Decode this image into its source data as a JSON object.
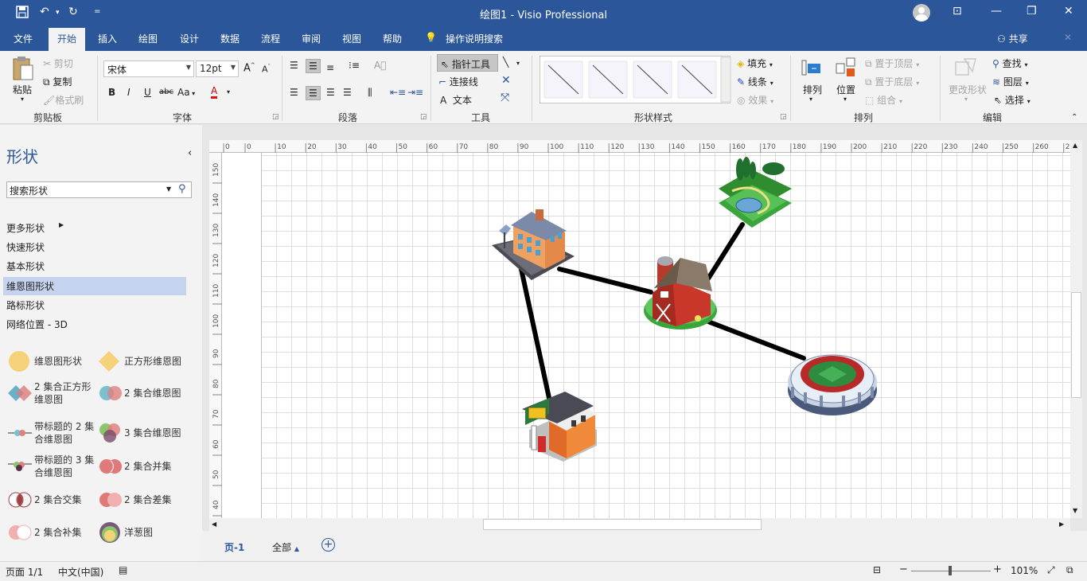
{
  "titlebar": {
    "title": "绘图1  -  Visio Professional"
  },
  "tabs": [
    "文件",
    "开始",
    "插入",
    "绘图",
    "设计",
    "数据",
    "流程",
    "审阅",
    "视图",
    "帮助"
  ],
  "tell_me": "操作说明搜索",
  "share": "共享",
  "ribbon": {
    "clipboard": {
      "paste": "粘贴",
      "cut": "剪切",
      "copy": "复制",
      "format_painter": "格式刷",
      "label": "剪贴板"
    },
    "font": {
      "name": "宋体",
      "size": "12pt",
      "bold": "B",
      "italic": "I",
      "underline": "U",
      "strike": "abc",
      "case": "Aa",
      "color": "A",
      "grow": "A",
      "shrink": "A",
      "label": "字体"
    },
    "paragraph": {
      "label": "段落"
    },
    "tools": {
      "pointer": "指针工具",
      "connector": "连接线",
      "text": "文本",
      "label": "工具"
    },
    "shape_styles": {
      "fill": "填充",
      "line": "线条",
      "effects": "效果",
      "label": "形状样式"
    },
    "arrange": {
      "arrange": "排列",
      "position": "位置",
      "bring_front": "置于顶层",
      "send_back": "置于底层",
      "group": "组合",
      "label": "排列"
    },
    "editing": {
      "change_shape": "更改形状",
      "find": "查找",
      "layers": "图层",
      "select": "选择",
      "label": "编辑"
    }
  },
  "shapes_pane": {
    "title": "形状",
    "search_placeholder": "搜索形状",
    "categories": [
      "更多形状",
      "快速形状",
      "基本形状",
      "维恩图形状",
      "路标形状",
      "网络位置 - 3D"
    ],
    "selected_category": "维恩图形状",
    "stencils": [
      {
        "label": "维恩图形状"
      },
      {
        "label": "正方形维恩图"
      },
      {
        "label": "2 集合正方形维恩图"
      },
      {
        "label": "2 集合维恩图"
      },
      {
        "label": "带标题的 2 集合维恩图"
      },
      {
        "label": "3 集合维恩图"
      },
      {
        "label": "带标题的 3 集合维恩图"
      },
      {
        "label": "2 集合并集"
      },
      {
        "label": "2 集合交集"
      },
      {
        "label": "2 集合差集"
      },
      {
        "label": "2 集合补集"
      },
      {
        "label": "洋葱图"
      }
    ]
  },
  "ruler": {
    "top": [
      "0",
      "0",
      "10",
      "20",
      "30",
      "40",
      "50",
      "60",
      "70",
      "80",
      "90",
      "100",
      "110",
      "120",
      "130",
      "140",
      "150",
      "160",
      "170",
      "180",
      "190",
      "200",
      "210",
      "220",
      "230",
      "240",
      "250",
      "260",
      "270"
    ],
    "left": [
      "150",
      "140",
      "130",
      "120",
      "110",
      "100",
      "90",
      "80",
      "70",
      "60",
      "50",
      "40"
    ]
  },
  "diagram": {
    "nodes": [
      "town-building",
      "park",
      "barn",
      "stadium",
      "gas-station"
    ],
    "connections": [
      [
        "town-building",
        "barn"
      ],
      [
        "park",
        "barn"
      ],
      [
        "barn",
        "stadium"
      ],
      [
        "town-building",
        "gas-station"
      ]
    ]
  },
  "page_tabs": {
    "current": "页-1",
    "all": "全部"
  },
  "status": {
    "page": "页面 1/1",
    "language": "中文(中国)",
    "zoom": "101%"
  }
}
